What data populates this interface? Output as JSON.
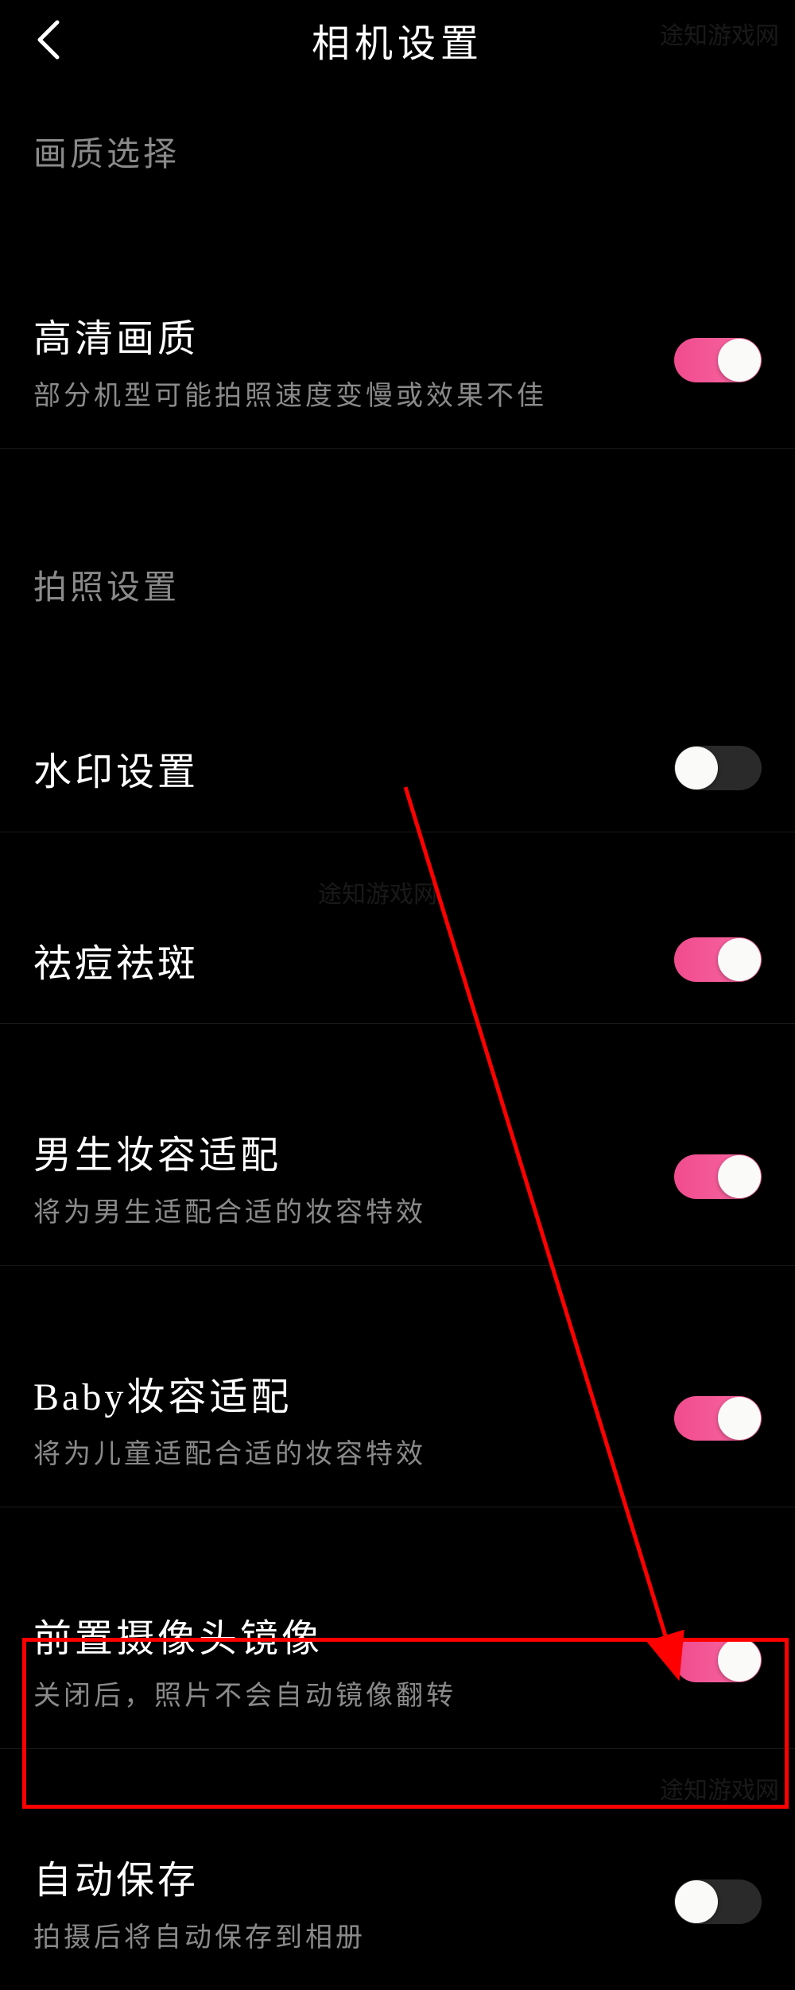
{
  "header": {
    "title": "相机设置"
  },
  "sections": {
    "quality": {
      "label": "画质选择"
    },
    "photo": {
      "label": "拍照设置"
    }
  },
  "settings": {
    "hdQuality": {
      "title": "高清画质",
      "desc": "部分机型可能拍照速度变慢或效果不佳",
      "on": true
    },
    "watermark": {
      "title": "水印设置",
      "on": false
    },
    "blemish": {
      "title": "祛痘祛斑",
      "on": true
    },
    "maleMakeup": {
      "title": "男生妆容适配",
      "desc": "将为男生适配合适的妆容特效",
      "on": true
    },
    "babyMakeup": {
      "title": "Baby妆容适配",
      "desc": "将为儿童适配合适的妆容特效",
      "on": true
    },
    "frontMirror": {
      "title": "前置摄像头镜像",
      "desc": "关闭后，照片不会自动镜像翻转",
      "on": true
    },
    "autoSave": {
      "title": "自动保存",
      "desc": "拍摄后将自动保存到相册",
      "on": false
    }
  },
  "watermarks": {
    "wm1": "途知游戏网",
    "wm2": "途知游戏网",
    "wm3": "途知游戏网"
  }
}
